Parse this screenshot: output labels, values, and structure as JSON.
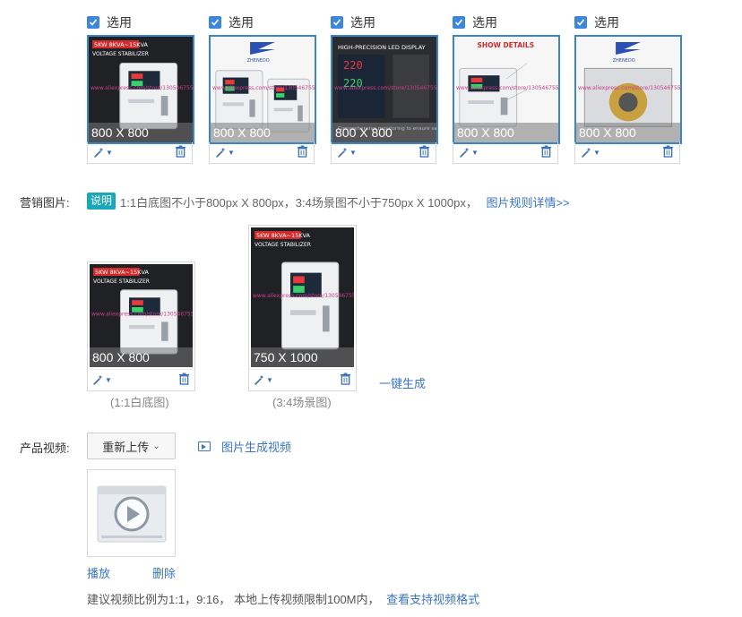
{
  "product_images": [
    {
      "checkbox_label": "选用",
      "size": "800 X 800",
      "style": "dark",
      "heading": "5KW 8KVA~15KVA",
      "sub": "VOLTAGE STABILIZER"
    },
    {
      "checkbox_label": "选用",
      "size": "800 X 800",
      "style": "light",
      "heading": "ZHENEDO",
      "sub": ""
    },
    {
      "checkbox_label": "选用",
      "size": "800 X 800",
      "style": "dark",
      "heading": "HIGH-PRECISION LED DISPLAY",
      "sub": "Comprehensive monitoring to ensure safe and operation"
    },
    {
      "checkbox_label": "选用",
      "size": "800 X 800",
      "style": "light",
      "heading": "SHOW DETAILS",
      "sub": ""
    },
    {
      "checkbox_label": "选用",
      "size": "800 X 800",
      "style": "light",
      "heading": "ZHENEDO",
      "sub": ""
    }
  ],
  "watermark": "www.aliexpress.com/store/1305467555",
  "marketing": {
    "label": "营销图片:",
    "badge": "说明",
    "note": "1:1白底图不小于800px X 800px，3:4场景图不小于750px X 1000px，",
    "rules_link": "图片规则详情>>",
    "images": [
      {
        "size": "800 X 800",
        "caption": "(1:1白底图)",
        "heading": "5KW 8KVA~15KVA",
        "sub": "VOLTAGE STABILIZER"
      },
      {
        "size": "750 X 1000",
        "caption": "(3:4场景图)",
        "heading": "5KW 8KVA~15KVA",
        "sub": "VOLTAGE STABILIZER"
      }
    ],
    "generate": "一键生成"
  },
  "video": {
    "label": "产品视频:",
    "reupload": "重新上传",
    "gen_link": "图片生成视频",
    "play": "播放",
    "delete": "删除",
    "hint": "建议视频比例为1:1，9:16， 本地上传视频限制100M内，",
    "formats_link": "查看支持视频格式"
  },
  "colors": {
    "accent": "#3d87d9",
    "link": "#3a75c4",
    "badge": "#1aa7b7"
  }
}
